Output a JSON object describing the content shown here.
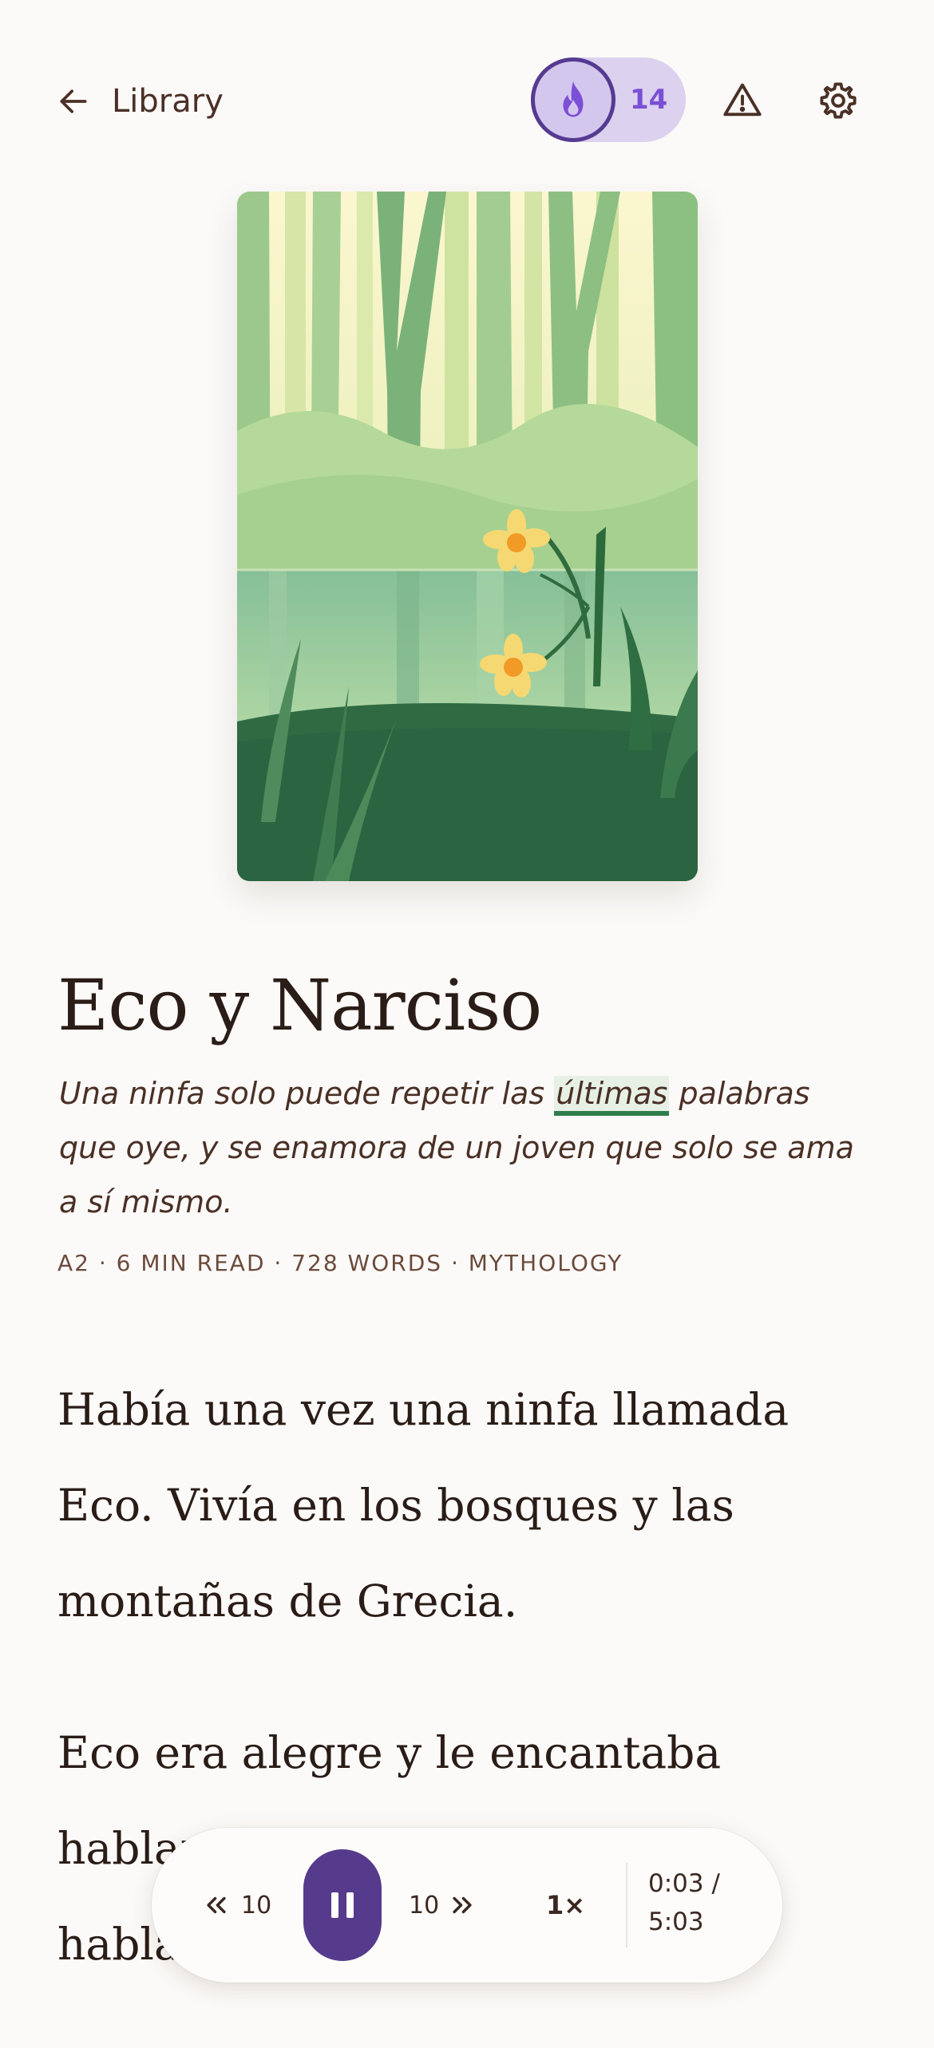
{
  "header": {
    "back_label": "Library",
    "streak_count": "14"
  },
  "story": {
    "title": "Eco y Narciso",
    "subtitle_before": "Una ninfa solo puede repetir las ",
    "subtitle_highlight": "últimas",
    "subtitle_after": " palabras que oye, y se enamora de un joven que solo se ama a sí mismo.",
    "meta": "A2 · 6 MIN READ · 728 WORDS · MYTHOLOGY"
  },
  "body": {
    "paragraphs": [
      "Había una vez una ninfa llamada Eco. Vivía en los bosques y las montañas de Grecia.",
      "Eco era alegre y le encantaba hablar. Tenía"
    ],
    "line3_visible": "habla"
  },
  "player": {
    "rewind_seconds": "10",
    "forward_seconds": "10",
    "speed": "1×",
    "time_current": "0:03 /",
    "time_total": "5:03"
  },
  "colors": {
    "background": "#fcfaf8",
    "accent_purple": "#563a8c",
    "streak_bg": "#dcd1ee",
    "streak_text": "#7b4fd6",
    "highlight_underline": "#2f7d4c",
    "text_dark": "#2a1c16"
  }
}
